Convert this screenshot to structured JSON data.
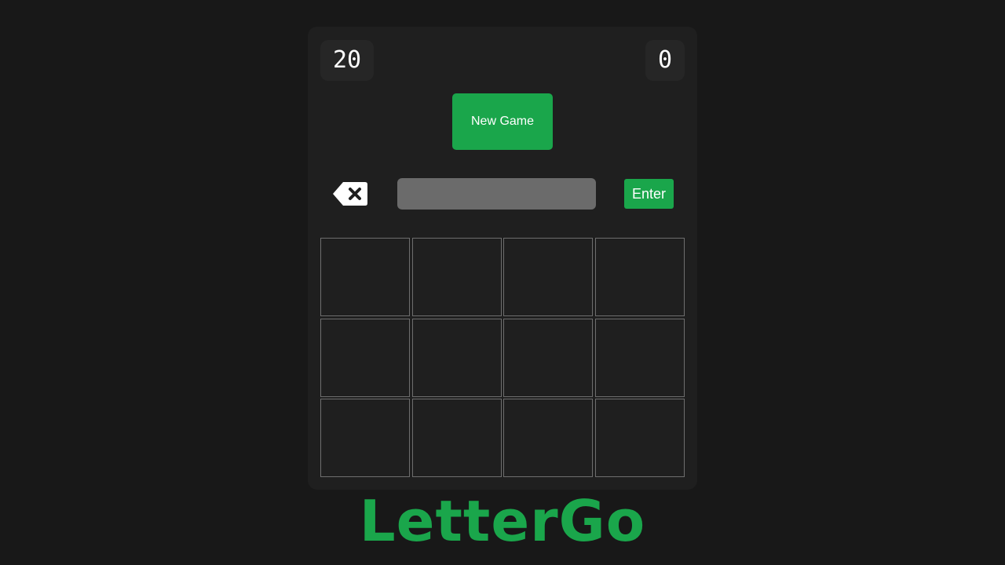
{
  "game": {
    "left_counter": "20",
    "right_counter": "0"
  },
  "controls": {
    "new_game_label": "New Game",
    "enter_label": "Enter",
    "input_value": "",
    "backspace_icon": "backspace-icon"
  },
  "board": {
    "rows": 3,
    "cols": 4,
    "cells": [
      "",
      "",
      "",
      "",
      "",
      "",
      "",
      "",
      "",
      "",
      "",
      ""
    ]
  },
  "logo": "LetterGo",
  "colors": {
    "accent": "#1aa64b",
    "background": "#181818",
    "panel": "#1f1f1f",
    "counter_bg": "#262626",
    "input_bg": "#6b6b6b",
    "cell_border": "#6e6e6e"
  }
}
